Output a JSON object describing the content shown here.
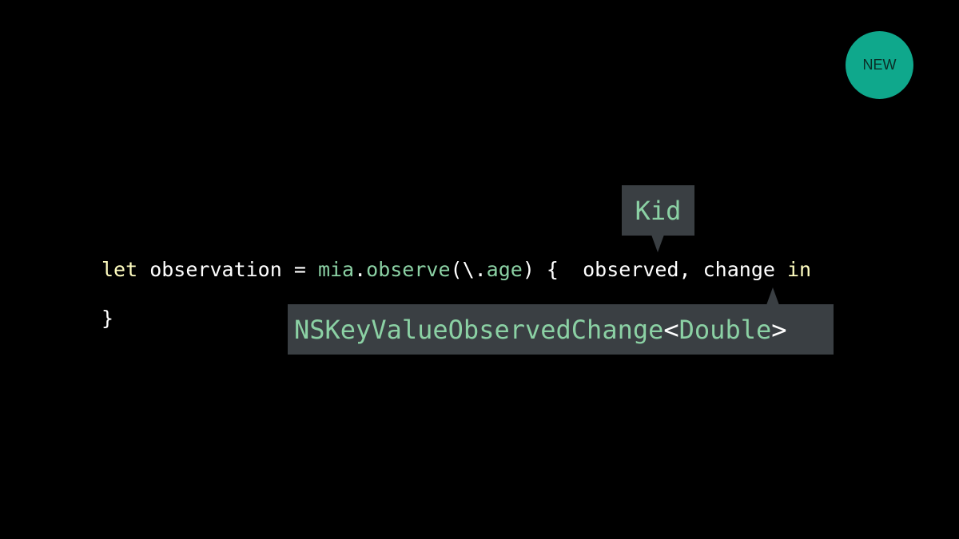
{
  "badge": {
    "label": "NEW"
  },
  "code": {
    "line1": {
      "kw_let": "let",
      "text_observation": " observation = ",
      "mia": "mia",
      "dot1": ".",
      "observe": "observe",
      "paren_open": "(\\.",
      "age": "age",
      "paren_close_brace": ") {  ",
      "observed": "observed, ",
      "change": "change ",
      "kw_in": "in"
    },
    "line2": {
      "brace_close": "}"
    }
  },
  "tooltip_observed": {
    "type": "Kid"
  },
  "tooltip_change": {
    "type": "NSKeyValueObservedChange",
    "lt": "<",
    "generic": "Double",
    "gt": ">"
  },
  "colors": {
    "background": "#000000",
    "badge": "#0fa88c",
    "keyword": "#fffdc0",
    "identifier": "#8bd1a4",
    "tooltip_bg": "#3a3f43"
  }
}
